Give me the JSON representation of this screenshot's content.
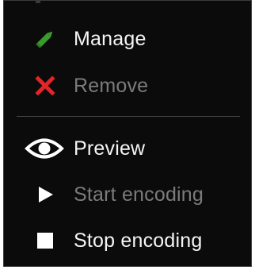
{
  "menu": {
    "items": [
      {
        "label": "Manage",
        "icon": "pencil-icon",
        "enabled": true,
        "icon_color": "#3a9a2e"
      },
      {
        "label": "Remove",
        "icon": "close-icon",
        "enabled": false,
        "icon_color": "#e0262a"
      },
      {
        "label": "Preview",
        "icon": "eye-icon",
        "enabled": true,
        "icon_color": "#ffffff"
      },
      {
        "label": "Start encoding",
        "icon": "play-icon",
        "enabled": false,
        "icon_color": "#ffffff"
      },
      {
        "label": "Stop encoding",
        "icon": "stop-icon",
        "enabled": true,
        "icon_color": "#ffffff"
      }
    ]
  },
  "colors": {
    "background": "#0b0b0b",
    "enabled_text": "#f5f5f5",
    "disabled_text": "#7b7b7b",
    "divider": "#4a4a4a"
  }
}
